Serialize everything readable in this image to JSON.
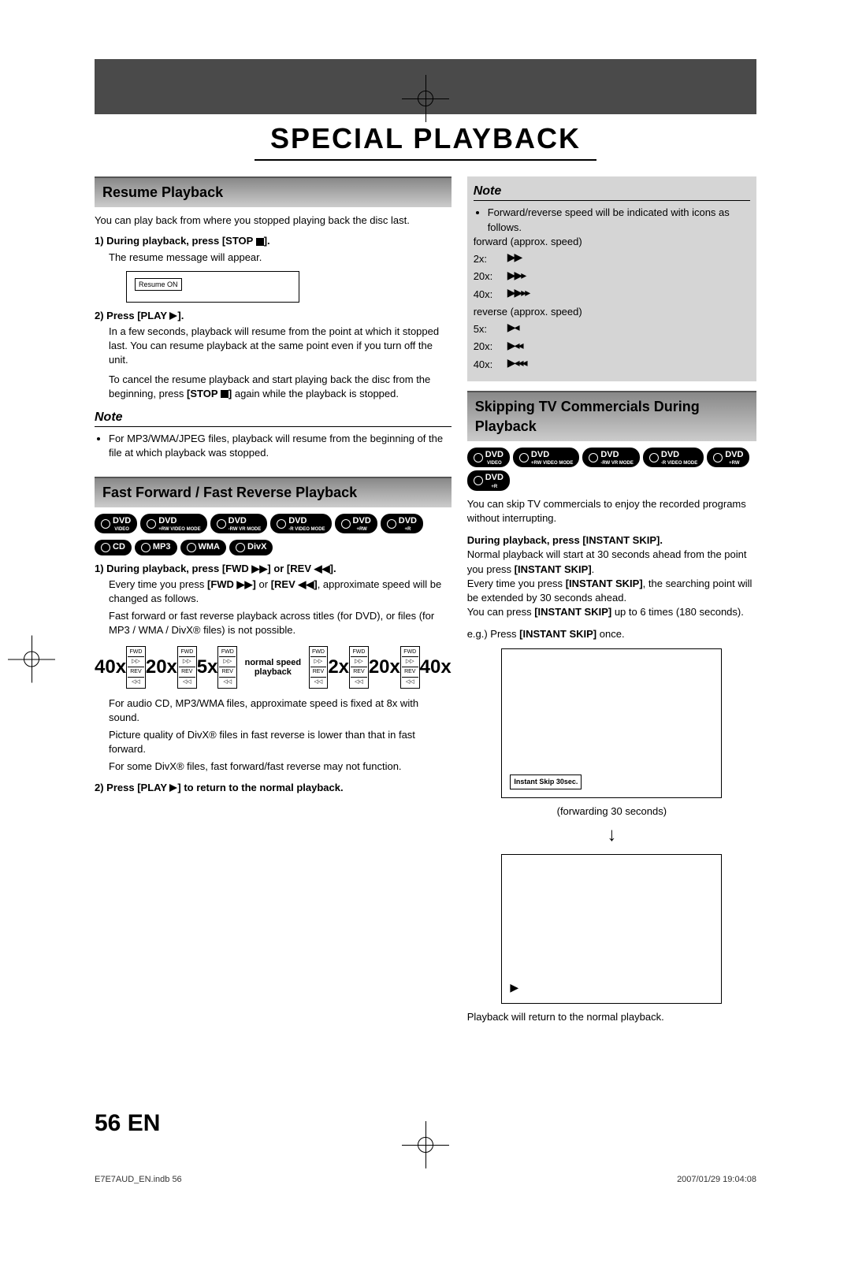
{
  "page_title": "SPECIAL PLAYBACK",
  "page_number": "56",
  "page_lang": "EN",
  "footer_left": "E7E7AUD_EN.indb   56",
  "footer_right": "2007/01/29   19:04:08",
  "left_col": {
    "resume": {
      "header": "Resume Playback",
      "intro": "You can play back from where you stopped playing back the disc last.",
      "step1_label": "1) During playback, press [STOP ",
      "step1_label2": "].",
      "step1_body": "The resume message will appear.",
      "resume_on": "Resume ON",
      "step2_label": "2) Press [PLAY ",
      "step2_label2": "].",
      "step2_body1": "In a few seconds, playback will resume from the point at which it stopped last. You can resume playback at the same point even if you turn off the unit.",
      "step2_body2a": "To cancel the resume playback and start playing back the disc from the beginning, press ",
      "step2_body2b": "[STOP ",
      "step2_body2c": "]",
      "step2_body2d": " again while the playback is stopped.",
      "note_label": "Note",
      "note_item": "For MP3/WMA/JPEG files, playback will resume from the beginning of the file at which playback was stopped."
    },
    "ff": {
      "header": "Fast Forward / Fast Reverse Playback",
      "badges_row1": [
        "DVD VIDEO",
        "DVD +RW VIDEO MODE",
        "DVD -RW VR MODE",
        "DVD -R VIDEO MODE",
        "DVD +RW",
        "DVD +R"
      ],
      "badges_row2": [
        "CD",
        "MP3",
        "WMA",
        "DivX"
      ],
      "step1_label_a": "1) During playback, press [FWD ",
      "step1_label_b": "] or [REV ",
      "step1_label_c": "].",
      "step1_body1a": "Every time you press ",
      "step1_body1b": "[FWD ",
      "step1_body1c": "]",
      "step1_body1d": " or ",
      "step1_body1e": "[REV ",
      "step1_body1f": "]",
      "step1_body1g": ", approximate speed will be changed as follows.",
      "step1_body2": "Fast forward or fast reverse playback across titles (for DVD), or files (for MP3 / WMA / DivX® files) is not possible.",
      "speeds_rev": [
        "40x",
        "20x",
        "5x"
      ],
      "normal_label": "normal speed playback",
      "speeds_fwd": [
        "2x",
        "20x",
        "40x"
      ],
      "speed_box_fwd": "FWD",
      "speed_box_ff": "▷▷",
      "speed_box_rev": "REV",
      "speed_box_rr": "◁◁",
      "after1": "For audio CD, MP3/WMA files, approximate speed is fixed at 8x with sound.",
      "after2": "Picture quality of DivX® files in fast reverse is lower than that in fast forward.",
      "after3": "For some DivX® files, fast forward/fast reverse may not function.",
      "step2_label_a": "2) Press [PLAY ",
      "step2_label_b": "] to return to the normal playback."
    }
  },
  "right_col": {
    "note": {
      "header": "Note",
      "intro": "Forward/reverse speed will be indicated with icons as follows.",
      "fwd_label": "forward (approx. speed)",
      "fwd_rows": [
        {
          "label": "2x:",
          "icon": "▶▶"
        },
        {
          "label": "20x:",
          "icon": "▶▶▸"
        },
        {
          "label": "40x:",
          "icon": "▶▶▸▸"
        }
      ],
      "rev_label": "reverse (approx. speed)",
      "rev_rows": [
        {
          "label": "5x:",
          "icon": "▶◂"
        },
        {
          "label": "20x:",
          "icon": "▶◂◂"
        },
        {
          "label": "40x:",
          "icon": "▶◂◂◂"
        }
      ]
    },
    "skip": {
      "header": "Skipping TV Commercials During Playback",
      "badges": [
        "DVD VIDEO",
        "DVD +RW VIDEO MODE",
        "DVD -RW VR MODE",
        "DVD -R VIDEO MODE",
        "DVD +RW",
        "DVD +R"
      ],
      "intro": "You can skip TV commercials to enjoy the recorded programs without interrupting.",
      "step_label": "During playback, press [INSTANT SKIP].",
      "body1a": "Normal playback will start at 30 seconds ahead from the point you press ",
      "body1b": "[INSTANT SKIP]",
      "body1c": ".",
      "body2a": "Every time you press ",
      "body2b": "[INSTANT SKIP]",
      "body2c": ", the searching point will be extended by 30 seconds ahead.",
      "body3a": "You can press ",
      "body3b": "[INSTANT SKIP]",
      "body3c": " up to 6 times (180 seconds).",
      "example_label_a": "e.g.) Press ",
      "example_label_b": "[INSTANT SKIP]",
      "example_label_c": " once.",
      "instant_skip_box": "Instant Skip 30sec.",
      "caption1": "(forwarding 30 seconds)",
      "play_icon": "▶",
      "caption2": "Playback will return to the normal playback."
    }
  }
}
